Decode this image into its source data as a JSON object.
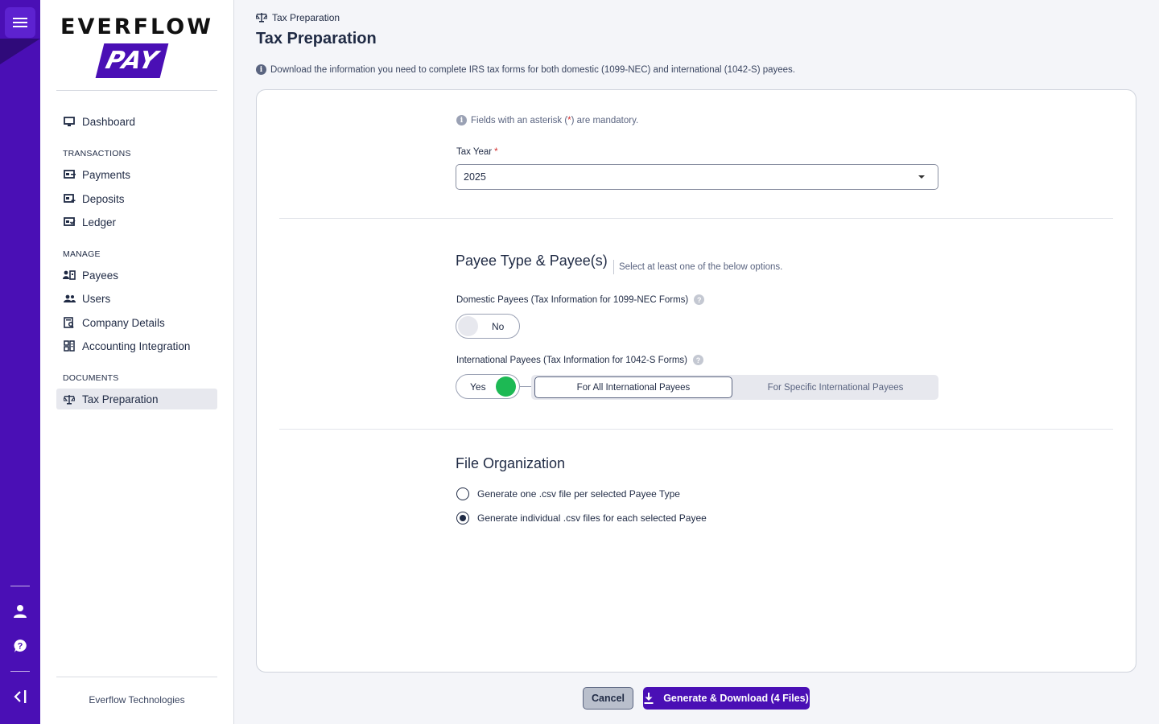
{
  "brand": {
    "word": "EVERFLOW",
    "pay": "PAY",
    "footer": "Everflow Technologies",
    "accent": "#4a0fb5"
  },
  "rail": {
    "menu_icon": "hamburger-icon",
    "user_icon": "user-icon",
    "help_icon": "help-icon",
    "collapse_icon": "collapse-sidebar-icon"
  },
  "sidebar": {
    "dashboard": "Dashboard",
    "sections": {
      "transactions": "TRANSACTIONS",
      "manage": "MANAGE",
      "documents": "DOCUMENTS"
    },
    "items": {
      "payments": "Payments",
      "deposits": "Deposits",
      "ledger": "Ledger",
      "payees": "Payees",
      "users": "Users",
      "company_details": "Company Details",
      "accounting_integration": "Accounting Integration",
      "tax_preparation": "Tax Preparation"
    }
  },
  "header": {
    "breadcrumb": "Tax Preparation",
    "title": "Tax Preparation",
    "info": "Download the information you need to complete IRS tax forms for both domestic (1099-NEC) and international (1042-S) payees."
  },
  "form": {
    "mandatory_prefix": "Fields with an asterisk (",
    "mandatory_ast": "*",
    "mandatory_suffix": ") are mandatory.",
    "tax_year_label": "Tax Year",
    "required_mark": "*",
    "tax_year_value": "2025",
    "payee_section_title": "Payee Type & Payee(s)",
    "payee_section_sub": "Select at least one of the below options.",
    "domestic_label": "Domestic Payees (Tax Information for 1099-NEC Forms)",
    "domestic_toggle": "No",
    "international_label": "International Payees (Tax Information for 1042-S Forms)",
    "international_toggle": "Yes",
    "intl_options": {
      "all": "For All International Payees",
      "specific": "For Specific International Payees",
      "selected": "all"
    },
    "file_org_title": "File Organization",
    "file_org_options": {
      "one_per_type": "Generate one .csv file per selected Payee Type",
      "individual": "Generate individual .csv files for each selected Payee",
      "selected": "individual"
    }
  },
  "actions": {
    "cancel": "Cancel",
    "generate": "Generate & Download (4 Files)"
  },
  "colors": {
    "toggle_on": "#1db954",
    "toggle_off": "#e7e8ee",
    "required": "#d32f2f"
  }
}
